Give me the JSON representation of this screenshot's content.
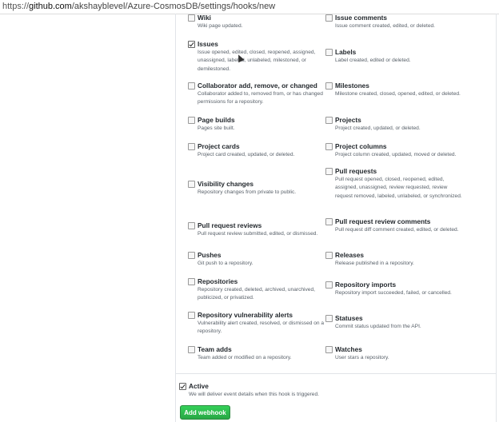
{
  "browser": {
    "url_scheme": "https://",
    "url_host": "github.com",
    "url_path": "/akshayblevel/Azure-CosmosDB/settings/hooks/new"
  },
  "events": {
    "left": [
      {
        "title": "Wiki",
        "desc": "Wiki page updated.",
        "checked": false
      },
      {
        "title": "Issues",
        "desc": "Issue opened, edited, closed, reopened, assigned, unassigned, labeled, unlabeled, milestoned, or demilestoned.",
        "checked": true
      },
      {
        "title": "Collaborator add, remove, or changed",
        "desc": "Collaborator added to, removed from, or has changed permissions for a repository.",
        "checked": false
      },
      {
        "title": "Page builds",
        "desc": "Pages site built.",
        "checked": false
      },
      {
        "title": "Project cards",
        "desc": "Project card created, updated, or deleted.",
        "checked": false
      },
      {
        "title": "Visibility changes",
        "desc": "Repository changes from private to public.",
        "checked": false
      },
      {
        "title": "Pull request reviews",
        "desc": "Pull request review submitted, edited, or dismissed.",
        "checked": false
      },
      {
        "title": "Pushes",
        "desc": "Git push to a repository.",
        "checked": false
      },
      {
        "title": "Repositories",
        "desc": "Repository created, deleted, archived, unarchived, publicized, or privatized.",
        "checked": false
      },
      {
        "title": "Repository vulnerability alerts",
        "desc": "Vulnerability alert created, resolved, or dismissed on a repository.",
        "checked": false
      },
      {
        "title": "Team adds",
        "desc": "Team added or modified on a repository.",
        "checked": false
      }
    ],
    "right": [
      {
        "title": "Issue comments",
        "desc": "Issue comment created, edited, or deleted.",
        "checked": false
      },
      {
        "title": "Labels",
        "desc": "Label created, edited or deleted.",
        "checked": false
      },
      {
        "title": "Milestones",
        "desc": "Milestone created, closed, opened, edited, or deleted.",
        "checked": false
      },
      {
        "title": "Projects",
        "desc": "Project created, updated, or deleted.",
        "checked": false
      },
      {
        "title": "Project columns",
        "desc": "Project column created, updated, moved or deleted.",
        "checked": false
      },
      {
        "title": "Pull requests",
        "desc": "Pull request opened, closed, reopened, edited, assigned, unassigned, review requested, review request removed, labeled, unlabeled, or synchronized.",
        "checked": false
      },
      {
        "title": "Pull request review comments",
        "desc": "Pull request diff comment created, edited, or deleted.",
        "checked": false
      },
      {
        "title": "Releases",
        "desc": "Release published in a repository.",
        "checked": false
      },
      {
        "title": "Repository imports",
        "desc": "Repository import succeeded, failed, or cancelled.",
        "checked": false
      },
      {
        "title": "Statuses",
        "desc": "Commit status updated from the API.",
        "checked": false
      },
      {
        "title": "Watches",
        "desc": "User stars a repository.",
        "checked": false
      }
    ]
  },
  "active": {
    "title": "Active",
    "desc": "We will deliver event details when this hook is triggered.",
    "checked": true
  },
  "add_button": "Add webhook"
}
